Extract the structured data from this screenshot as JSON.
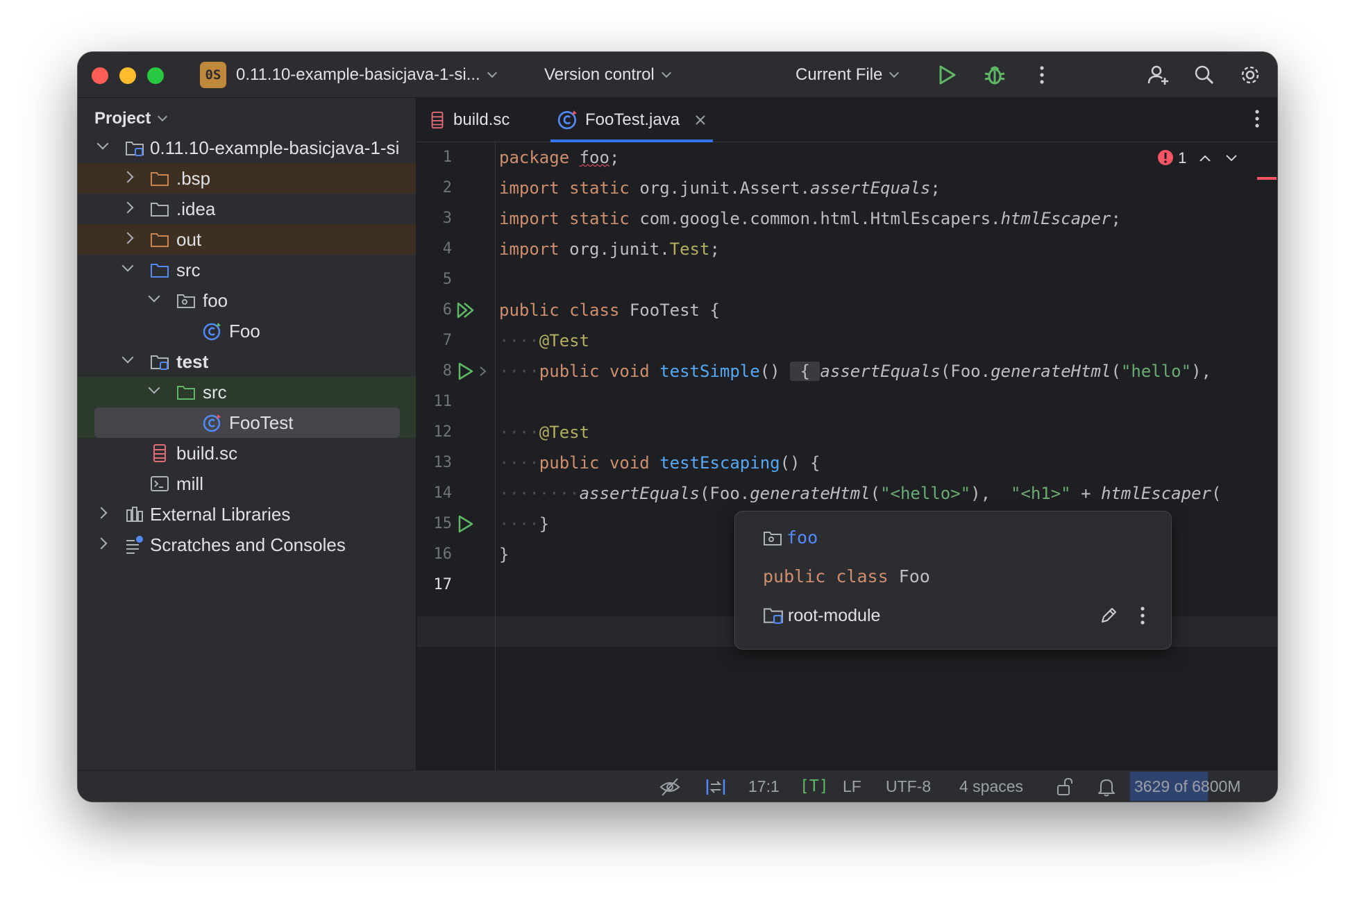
{
  "titlebar": {
    "project_badge": "0S",
    "project_name": "0.11.10-example-basicjava-1-si...",
    "vcs_label": "Version control",
    "run_config": "Current File"
  },
  "project_panel": {
    "title": "Project",
    "items": [
      {
        "label": "0.11.10-example-basicjava-1-si",
        "icon": "module-folder-icon"
      },
      {
        "label": ".bsp",
        "icon": "folder-icon"
      },
      {
        "label": ".idea",
        "icon": "folder-icon"
      },
      {
        "label": "out",
        "icon": "folder-icon"
      },
      {
        "label": "src",
        "icon": "source-folder-icon"
      },
      {
        "label": "foo",
        "icon": "package-icon"
      },
      {
        "label": "Foo",
        "icon": "java-class-icon"
      },
      {
        "label": "test",
        "icon": "module-folder-icon"
      },
      {
        "label": "src",
        "icon": "test-folder-icon"
      },
      {
        "label": "FooTest",
        "icon": "java-class-icon"
      },
      {
        "label": "build.sc",
        "icon": "build-file-icon"
      },
      {
        "label": "mill",
        "icon": "terminal-file-icon"
      },
      {
        "label": "External Libraries",
        "icon": "libraries-icon"
      },
      {
        "label": "Scratches and Consoles",
        "icon": "scratches-icon"
      }
    ]
  },
  "tabs": [
    {
      "label": "build.sc",
      "active": false
    },
    {
      "label": "FooTest.java",
      "active": true
    }
  ],
  "editor": {
    "error_count": "1",
    "line_numbers": [
      "1",
      "2",
      "3",
      "4",
      "5",
      "6",
      "7",
      "8",
      "11",
      "12",
      "13",
      "14",
      "15",
      "16",
      "17"
    ],
    "lines": {
      "l1_kw": "package",
      "l1_pkg": "foo",
      "l1_end": ";",
      "l2_kw": "import",
      "l2_kw2": "static",
      "l2_path": "org.junit.Assert.",
      "l2_member": "assertEquals",
      "l2_end": ";",
      "l3_kw": "import",
      "l3_kw2": "static",
      "l3_path": "com.google.common.html.HtmlEscapers.",
      "l3_member": "htmlEscaper",
      "l3_end": ";",
      "l4_kw": "import",
      "l4_path": "org.junit.",
      "l4_cls": "Test",
      "l4_end": ";",
      "l6_kw": "public",
      "l6_kw2": "class",
      "l6_name": "FooTest",
      "l6_end": "{",
      "l7_ann": "@Test",
      "l8_kw": "public",
      "l8_kw2": "void",
      "l8_fn": "testSimple",
      "l8_paren": "()",
      "l8_brace": "{",
      "l8_call": "assertEquals",
      "l8_args1": "(Foo.",
      "l8_gen": "generateHtml",
      "l8_args2": "(",
      "l8_str": "\"hello\"",
      "l8_args3": "),",
      "l12_ann": "@Test",
      "l13_kw": "public",
      "l13_kw2": "void",
      "l13_fn": "testEscaping",
      "l13_rest": "() {",
      "l14_call": "assertEquals",
      "l14_a1": "(Foo.",
      "l14_gen": "generateHtml",
      "l14_a2": "(",
      "l14_str1": "\"<hello>\"",
      "l14_a3": "),",
      "l14_str2": "\"<h1>\"",
      "l14_plus": "+",
      "l14_esc": "htmlEscaper",
      "l15_brace": "}",
      "l16_brace": "}"
    }
  },
  "popup": {
    "package_name": "foo",
    "kw_public": "public",
    "kw_class": "class",
    "class_name": "Foo",
    "module_name": "root-module"
  },
  "statusbar": {
    "position": "17:1",
    "mode": "[T]",
    "line_sep": "LF",
    "encoding": "UTF-8",
    "indent": "4 spaces",
    "memory": "3629 of 6800M",
    "memory_fraction": 0.53
  },
  "colors": {
    "accent": "#3574f0",
    "keyword": "#cf8e6d",
    "annotation": "#b3ae60",
    "function": "#56a8f5",
    "string": "#6aab73",
    "run_green": "#5fb865",
    "error_red": "#f75464"
  }
}
